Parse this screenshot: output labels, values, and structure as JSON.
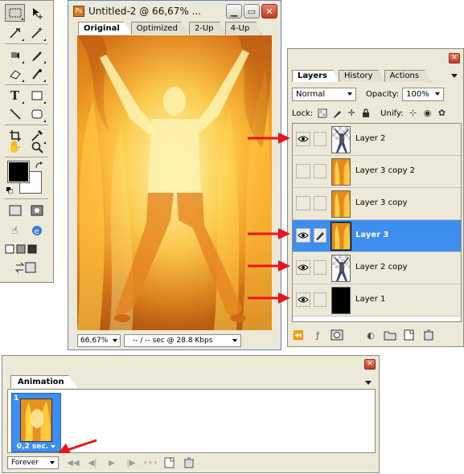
{
  "toolbox": {
    "tools": [
      [
        "marquee-icon",
        "move-icon"
      ],
      [
        "lasso-icon",
        "magic-wand-icon"
      ],
      [
        "crop-icon",
        "slice-icon"
      ],
      [
        "healing-icon",
        "brush-icon"
      ],
      [
        "stamp-icon",
        "history-brush-icon"
      ],
      [
        "eraser-icon",
        "gradient-icon"
      ],
      [
        "blur-icon",
        "dodge-icon"
      ],
      [
        "path-select-icon",
        "type-icon"
      ],
      [
        "pen-icon",
        "rectangle-icon"
      ],
      [
        "notes-icon",
        "eyedropper-icon"
      ],
      [
        "hand-icon",
        "zoom-icon"
      ]
    ],
    "colors": {
      "foreground": "#000000",
      "background": "#ffffff"
    }
  },
  "document": {
    "title": "Untitled-2 @ 66,67% ...",
    "tabs": [
      "Original",
      "Optimized",
      "2-Up",
      "4-Up"
    ],
    "active_tab": "Original",
    "zoom": "66,67%",
    "status": "-- / -- sec @ 28.8 Kbps"
  },
  "layers_panel": {
    "tabs": [
      "Layers",
      "History",
      "Actions"
    ],
    "active_tab": "Layers",
    "blend_mode": "Normal",
    "opacity_label": "Opacity:",
    "opacity": "100%",
    "lock_label": "Lock:",
    "unify_label": "Unify:",
    "layers": [
      {
        "name": "Layer 2",
        "visible": true,
        "selected": false,
        "thumb": "figure"
      },
      {
        "name": "Layer 3 copy 2",
        "visible": false,
        "selected": false,
        "thumb": "fire"
      },
      {
        "name": "Layer 3 copy",
        "visible": false,
        "selected": false,
        "thumb": "fire"
      },
      {
        "name": "Layer 3",
        "visible": true,
        "selected": true,
        "thumb": "fire"
      },
      {
        "name": "Layer 2 copy",
        "visible": true,
        "selected": false,
        "thumb": "figure"
      },
      {
        "name": "Layer 1",
        "visible": true,
        "selected": false,
        "thumb": "black"
      }
    ]
  },
  "animation_panel": {
    "tab": "Animation",
    "frames": [
      {
        "number": "1",
        "delay": "0,2 sec."
      }
    ],
    "loop": "Forever"
  },
  "colors": {
    "selection_blue": "#3e8ef0",
    "annotation_red": "#e8141c",
    "panel_bg": "#ece9d8"
  }
}
